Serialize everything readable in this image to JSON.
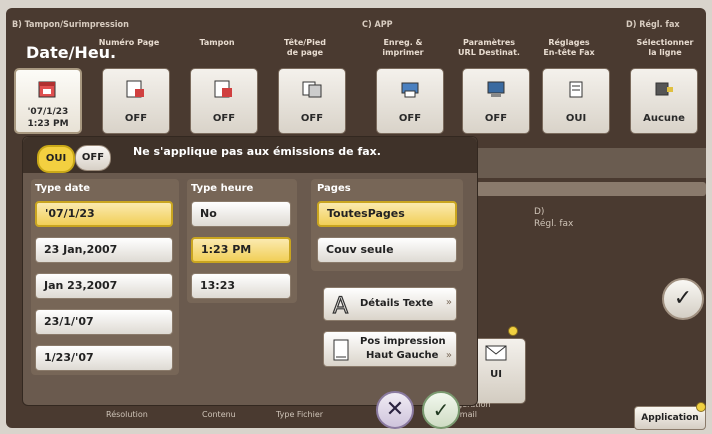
{
  "sections": {
    "b": "B)  Tampon/Surimpression",
    "c": "C)  APP",
    "d": "D)  Régl. fax"
  },
  "header": {
    "title": "Date/Heu."
  },
  "tabs": [
    {
      "label": "Numéro Page",
      "value": "OFF"
    },
    {
      "label": "Tampon",
      "value": "OFF"
    },
    {
      "label": "Tête/Pied\nde page",
      "value": "OFF"
    },
    {
      "label": "Enreg. &\nimprimer",
      "value": "OFF"
    },
    {
      "label": "Paramètres\nURL Destinat.",
      "value": "OFF"
    },
    {
      "label": "Réglages\nEn-tête Fax",
      "value": "OUI"
    },
    {
      "label": "Sélectionner\nla ligne",
      "value": "Aucune"
    }
  ],
  "active_tile": {
    "value": "'07/1/23\n1:23 PM"
  },
  "popup": {
    "on": "OUI",
    "off": "OFF",
    "note": "Ne s'applique pas aux émissions de fax.",
    "type_date": {
      "label": "Type date",
      "options": [
        "'07/1/23",
        "23 Jan,2007",
        "Jan 23,2007",
        "23/1/'07",
        "1/23/'07"
      ]
    },
    "type_heure": {
      "label": "Type heure",
      "options": [
        "No",
        "1:23 PM",
        "13:23"
      ]
    },
    "pages": {
      "label": "Pages",
      "options": [
        "ToutesPages",
        "Couv seule"
      ]
    },
    "details_texte": "Détails Texte",
    "pos_impression_l1": "Pos impression",
    "pos_impression_l2": "Haut Gauche"
  },
  "background": {
    "regl_fax": "D)\nRégl. fax",
    "email_value": "UI",
    "email_label": "ngération\ne-mail",
    "bottom_labels": [
      "Résolution",
      "Contenu",
      "Type Fichier"
    ],
    "application": "Application"
  },
  "colors": {
    "selected": "#f1cf58",
    "frame": "#4a3a30"
  }
}
